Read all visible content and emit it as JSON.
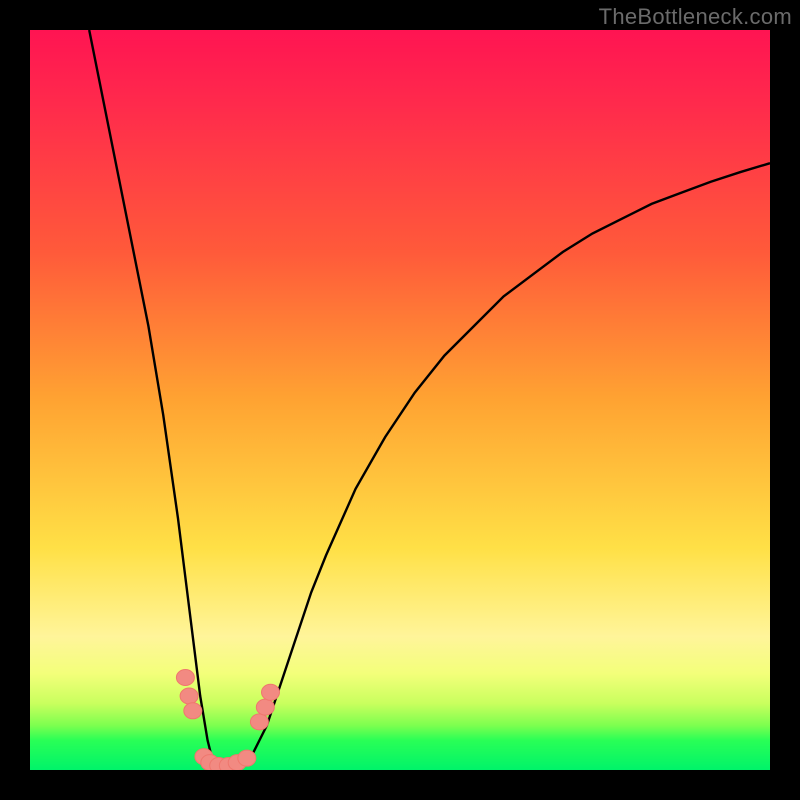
{
  "watermark": {
    "text": "TheBottleneck.com"
  },
  "colors": {
    "curve": "#000000",
    "bead_fill": "#f28a82",
    "bead_stroke": "#ef776e"
  },
  "chart_data": {
    "type": "line",
    "title": "",
    "xlabel": "",
    "ylabel": "",
    "xlim": [
      0,
      100
    ],
    "ylim": [
      0,
      100
    ],
    "grid": false,
    "legend": false,
    "series": [
      {
        "name": "curve",
        "x": [
          8,
          10,
          12,
          14,
          16,
          18,
          20,
          21,
          22,
          23,
          24,
          25,
          26,
          27,
          28,
          30,
          32,
          34,
          36,
          38,
          40,
          44,
          48,
          52,
          56,
          60,
          64,
          68,
          72,
          76,
          80,
          84,
          88,
          92,
          96,
          100
        ],
        "y": [
          100,
          90,
          80,
          70,
          60,
          48,
          34,
          26,
          18,
          10,
          4,
          0,
          0,
          0,
          0,
          2,
          6,
          12,
          18,
          24,
          29,
          38,
          45,
          51,
          56,
          60,
          64,
          67,
          70,
          72.5,
          74.5,
          76.5,
          78,
          79.5,
          80.8,
          82
        ]
      }
    ],
    "beads": {
      "name": "markers",
      "points": [
        {
          "x": 21.0,
          "y": 12.5
        },
        {
          "x": 21.5,
          "y": 10.0
        },
        {
          "x": 22.0,
          "y": 8.0
        },
        {
          "x": 23.5,
          "y": 1.8
        },
        {
          "x": 24.3,
          "y": 1.0
        },
        {
          "x": 25.5,
          "y": 0.6
        },
        {
          "x": 26.8,
          "y": 0.6
        },
        {
          "x": 28.0,
          "y": 1.0
        },
        {
          "x": 29.3,
          "y": 1.6
        },
        {
          "x": 31.0,
          "y": 6.5
        },
        {
          "x": 31.8,
          "y": 8.5
        },
        {
          "x": 32.5,
          "y": 10.5
        }
      ]
    }
  }
}
